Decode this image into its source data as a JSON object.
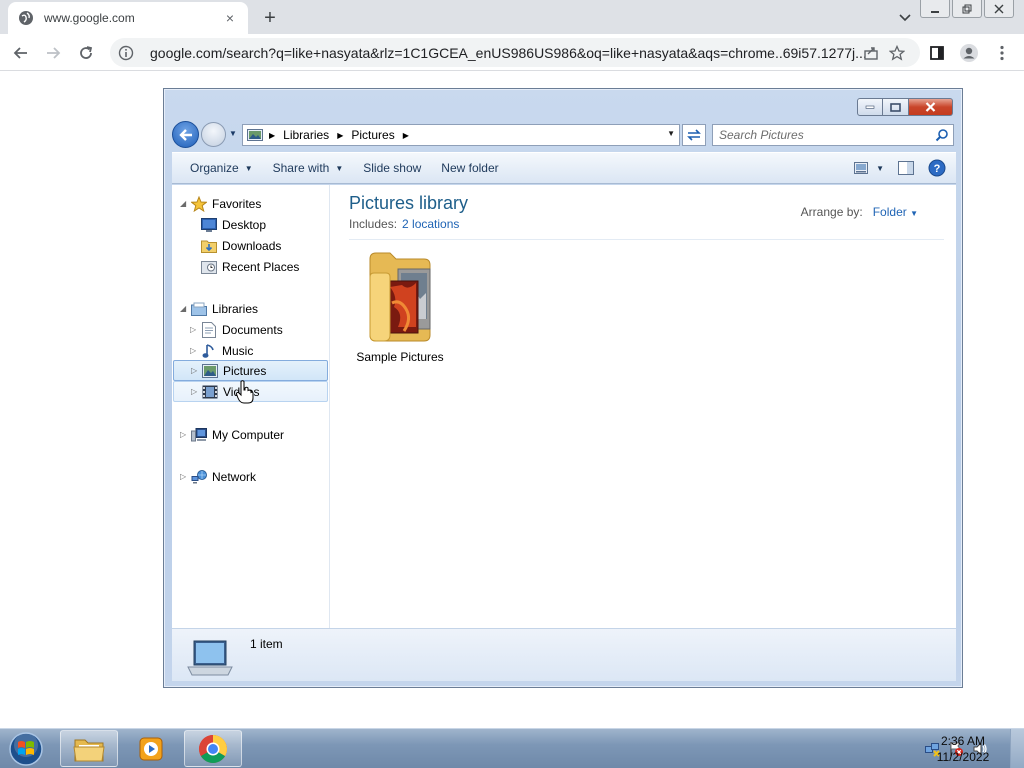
{
  "browser": {
    "tab_title": "www.google.com",
    "tab_close": "×",
    "new_tab": "+",
    "url": "google.com/search?q=like+nasyata&rlz=1C1GCEA_enUS986US986&oq=like+nasyata&aqs=chrome..69i57.1277j..."
  },
  "explorer": {
    "breadcrumb": [
      "Libraries",
      "Pictures"
    ],
    "search_placeholder": "Search Pictures",
    "commands": {
      "organize": "Organize",
      "share_with": "Share with",
      "slide_show": "Slide show",
      "new_folder": "New folder"
    },
    "nav": {
      "favorites": "Favorites",
      "desktop": "Desktop",
      "downloads": "Downloads",
      "recent_places": "Recent Places",
      "libraries": "Libraries",
      "documents": "Documents",
      "music": "Music",
      "pictures": "Pictures",
      "videos": "Videos",
      "my_computer": "My Computer",
      "network": "Network"
    },
    "content": {
      "title": "Pictures library",
      "includes_label": "Includes:",
      "includes_link": "2 locations",
      "arrange_label": "Arrange by:",
      "arrange_value": "Folder",
      "folder_name": "Sample Pictures"
    },
    "details": {
      "item_count": "1 item"
    }
  },
  "taskbar": {
    "time": "2:36 AM",
    "date": "11/2/2022"
  },
  "colors": {
    "chrome_tabstrip": "#dee1e6",
    "explorer_frame": "#b9cde8",
    "library_title": "#1e5e8a",
    "link": "#1f64b5",
    "taskbar": "#7d97b6"
  }
}
